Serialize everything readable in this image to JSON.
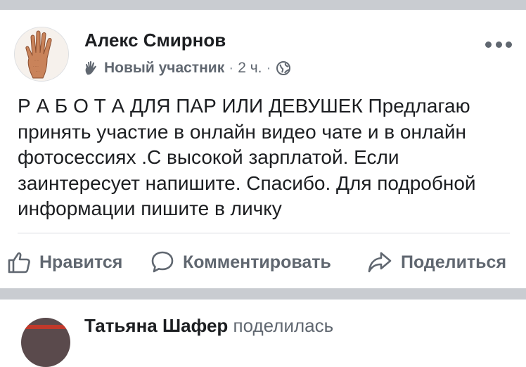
{
  "post": {
    "author": "Алекс Смирнов",
    "badge": "Новый участник",
    "separator": "·",
    "time": "2 ч.",
    "text": "Р А Б О Т А ДЛЯ ПАР ИЛИ ДЕВУШЕК Предлагаю принять участие в онлайн видео чате и в онлайн фотосессиях .С высокой зарплатой. Если заинтересует напишите. Спасибо. Для подробной информации пишите в личку"
  },
  "actions": {
    "like": "Нравится",
    "comment": "Комментировать",
    "share": "Поделиться"
  },
  "next_post": {
    "author": "Татьяна Шафер",
    "action": "поделилась"
  },
  "icons": {
    "avatar": "palm-hand-avatar",
    "badge": "waving-hand-icon",
    "audience": "globe-icon",
    "menu": "more-dots-icon",
    "like": "thumbs-up-icon",
    "comment": "comment-bubble-icon",
    "share": "share-arrow-icon"
  },
  "colors": {
    "text": "#1c1e21",
    "secondary": "#606770",
    "separator": "#c9ccd1",
    "divider": "#dadde1"
  }
}
